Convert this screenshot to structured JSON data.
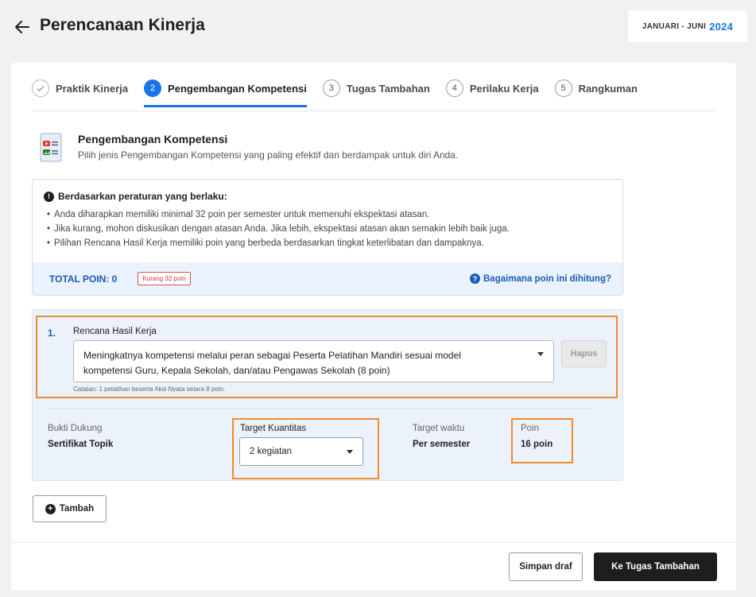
{
  "header": {
    "title": "Perencanaan Kinerja",
    "back_icon": "arrow-left-icon",
    "period_label": "JANUARI - JUNI",
    "period_year": "2024"
  },
  "stepper": {
    "steps": [
      {
        "marker": "✓",
        "label": "Praktik Kinerja",
        "state": "done"
      },
      {
        "marker": "2",
        "label": "Pengembangan Kompetensi",
        "state": "active"
      },
      {
        "marker": "3",
        "label": "Tugas Tambahan",
        "state": "pending"
      },
      {
        "marker": "4",
        "label": "Perilaku Kerja",
        "state": "pending"
      },
      {
        "marker": "5",
        "label": "Rangkuman",
        "state": "pending"
      }
    ]
  },
  "section": {
    "icon": "document-media-icon",
    "title": "Pengembangan Kompetensi",
    "subtitle": "Pilih jenis Pengembangan Kompetensi yang paling efektif dan berdampak untuk diri Anda."
  },
  "info": {
    "heading": "Berdasarkan peraturan yang berlaku:",
    "rules": [
      "Anda diharapkan memiliki minimal 32 poin per semester untuk memenuhi ekspektasi atasan.",
      "Jika kurang, mohon diskusikan dengan atasan Anda. Jika lebih, ekspektasi atasan akan semakin lebih baik juga.",
      "Pilihan Rencana Hasil Kerja memiliki poin yang berbeda berdasarkan tingkat keterlibatan dan dampaknya."
    ],
    "total_label": "TOTAL POIN: 0",
    "shortfall_badge": "Kurang 32 poin",
    "help_link": "Bagaimana poin ini dihitung?"
  },
  "item": {
    "number": "1.",
    "rhk_label": "Rencana Hasil Kerja",
    "rhk_value_line1": "Meningkatnya kompetensi melalui peran sebagai Peserta Pelatihan Mandiri sesuai model",
    "rhk_value_line2": "kompetensi Guru, Kepala Sekolah, dan/atau Pengawas Sekolah (8 poin)",
    "delete_label": "Hapus",
    "note": "Catatan: 1 pelatihan beserta Aksi Nyata setara 8 poin.",
    "evidence_label": "Bukti Dukung",
    "evidence_value": "Sertifikat Topik",
    "quantity_label": "Target Kuantitas",
    "quantity_value": "2 kegiatan",
    "time_label": "Target waktu",
    "time_value": "Per semester",
    "points_label": "Poin",
    "points_value": "16 poin"
  },
  "actions": {
    "add_label": "Tambah",
    "save_draft_label": "Simpan draf",
    "next_label": "Ke Tugas Tambahan"
  },
  "colors": {
    "accent": "#1a73e8",
    "highlight": "#f08a2c",
    "warning": "#d33333",
    "panel": "#ebf2fc"
  }
}
